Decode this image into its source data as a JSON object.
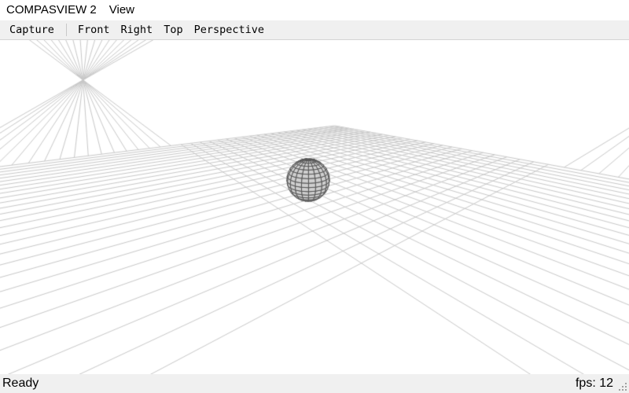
{
  "menubar": {
    "app_title": "COMPASVIEW 2",
    "view_menu": "View"
  },
  "toolbar": {
    "capture": "Capture",
    "front": "Front",
    "right": "Right",
    "top": "Top",
    "perspective": "Perspective"
  },
  "viewport": {
    "scene": "sphere-on-grid",
    "sphere_color": "#cfcfcf",
    "sphere_edge_color": "#555555",
    "grid_color": "#c8c8c8",
    "background": "#ffffff"
  },
  "statusbar": {
    "status": "Ready",
    "fps": "fps: 12"
  }
}
